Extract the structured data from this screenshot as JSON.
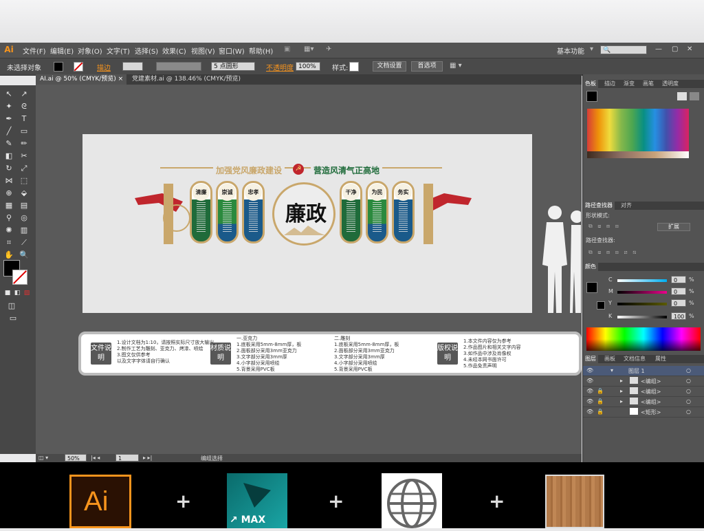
{
  "app": {
    "logo": "Ai"
  },
  "menu": {
    "items": [
      "文件(F)",
      "编辑(E)",
      "对象(O)",
      "文字(T)",
      "选择(S)",
      "效果(C)",
      "视图(V)",
      "窗口(W)",
      "帮助(H)"
    ],
    "workspace": "基本功能"
  },
  "control": {
    "selection": "未选择对象",
    "stroke_label": "描边",
    "brush": "5 点圆形",
    "opacity_label": "不透明度",
    "opacity_value": "100%",
    "style_label": "样式:",
    "doc_setup": "文档设置",
    "prefs": "首选项"
  },
  "tabs": [
    {
      "label": "AI.ai @ 50% (CMYK/预览)"
    },
    {
      "label": "党建素材.ai @ 138.46% (CMYK/预览)"
    }
  ],
  "artwork": {
    "banner_left": "加强党风廉政建设",
    "banner_right": "营造风清气正高地",
    "center_title": "廉政",
    "pills": [
      "清廉",
      "崇诚",
      "忠孝",
      "干净",
      "为民",
      "务实"
    ],
    "info": [
      {
        "title": "文件说明",
        "lines": [
          "1.设计文档为1:10，请按照实际尺寸放大输出",
          "2.制作工艺为雕刻、亚克力、烤漆、喷绘",
          "3.图文仅供参考",
          "以及文字字体请自行确认"
        ]
      },
      {
        "title": "材质说明",
        "lines": [
          "一.亚克力",
          "1.底板采用5mm-8mm厚，板",
          "2.面板部分采用3mm亚克力",
          "3.文字部分采用3mm厚",
          "4.小字部分采用喷绘",
          "5.背景采用PVC板"
        ]
      },
      {
        "title": "版权说明",
        "lines": [
          "1.本文件内容仅为参考",
          "2.作品图片和相关文字内容",
          "3.如作品中涉及肖像权",
          "4.未经本网书面许可",
          "5.作品免责声明"
        ]
      }
    ],
    "info_mid": [
      "二.雕刻",
      "1.底板采用5mm-8mm厚，板",
      "2.面板部分采用3mm亚克力",
      "3.文字部分采用3mm厚",
      "4.小字部分采用喷绘",
      "5.背景采用PVC板"
    ]
  },
  "panels": {
    "swatch_tabs": [
      "色板",
      "描边",
      "渐变",
      "画笔",
      "透明度"
    ],
    "pathfinder_tabs": [
      "路径查找器",
      "对齐"
    ],
    "shape_modes": "形状模式:",
    "expand": "扩展",
    "pathfinders": "路径查找器:",
    "color_tab": "颜色",
    "color_channels": [
      {
        "label": "C",
        "value": "0",
        "unit": "%"
      },
      {
        "label": "M",
        "value": "0",
        "unit": "%"
      },
      {
        "label": "Y",
        "value": "0",
        "unit": "%"
      },
      {
        "label": "K",
        "value": "100",
        "unit": "%"
      }
    ],
    "layer_tabs": [
      "图层",
      "画板",
      "文档信息",
      "属性"
    ],
    "layers": [
      {
        "name": "图层 1"
      },
      {
        "name": "<编组>"
      },
      {
        "name": "<编组>"
      },
      {
        "name": "<编组>"
      },
      {
        "name": "<矩形>"
      }
    ]
  },
  "status": {
    "zoom": "50%",
    "page": "1",
    "mode": "编组选择"
  },
  "bottom": {
    "ai_label": "Ai",
    "max_label": "MAX"
  },
  "colors": {
    "accent": "#f7941d",
    "panel_bg": "#535353",
    "canvas_bg": "#5a5a5a",
    "pill_green": "#1f6b3a",
    "pill_blue": "#1a5a8a",
    "red_ribbon": "#c0262d",
    "gold": "#c9a76b"
  }
}
